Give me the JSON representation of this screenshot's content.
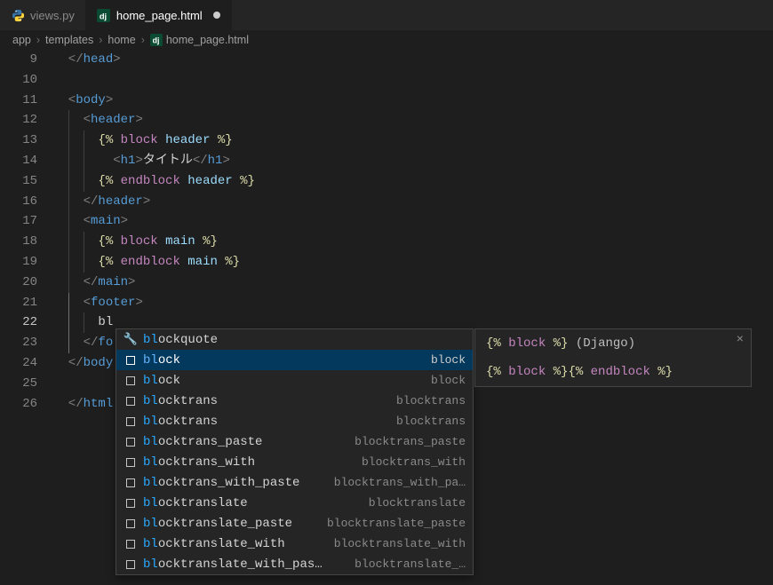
{
  "tabs": [
    {
      "label": "views.py",
      "active": false,
      "icon": "python"
    },
    {
      "label": "home_page.html",
      "active": true,
      "icon": "django",
      "dirty": true
    }
  ],
  "breadcrumbs": {
    "parts": [
      "app",
      "templates",
      "home",
      "home_page.html"
    ],
    "fileIcon": "django"
  },
  "lineNumbers": {
    "start": 9,
    "end": 26,
    "current": 22
  },
  "code": {
    "l9": "</head>",
    "l11_tag": "body",
    "l12_tag": "header",
    "l13_kw": "block",
    "l13_id": "header",
    "l14_tag": "h1",
    "l14_text": "タイトル",
    "l15_kw": "endblock",
    "l15_id": "header",
    "l16_tag": "header",
    "l17_tag": "main",
    "l18_kw": "block",
    "l18_id": "main",
    "l19_kw": "endblock",
    "l19_id": "main",
    "l20_tag": "main",
    "l21_tag": "footer",
    "l22_text": "bl",
    "l23_tag_partial": "fo",
    "l24_tag": "body",
    "l26_tag": "html"
  },
  "autocomplete": {
    "items": [
      {
        "prefix": "bl",
        "rest": "ockquote",
        "right": "",
        "kind": "property",
        "selected": false
      },
      {
        "prefix": "bl",
        "rest": "ock",
        "right": "block",
        "kind": "snippet",
        "selected": true
      },
      {
        "prefix": "bl",
        "rest": "ock",
        "right": "block",
        "kind": "snippet",
        "selected": false
      },
      {
        "prefix": "bl",
        "rest": "ocktrans",
        "right": "blocktrans",
        "kind": "snippet",
        "selected": false
      },
      {
        "prefix": "bl",
        "rest": "ocktrans",
        "right": "blocktrans",
        "kind": "snippet",
        "selected": false
      },
      {
        "prefix": "bl",
        "rest": "ocktrans_paste",
        "right": "blocktrans_paste",
        "kind": "snippet",
        "selected": false
      },
      {
        "prefix": "bl",
        "rest": "ocktrans_with",
        "right": "blocktrans_with",
        "kind": "snippet",
        "selected": false
      },
      {
        "prefix": "bl",
        "rest": "ocktrans_with_paste",
        "right": "blocktrans_with_pa…",
        "kind": "snippet",
        "selected": false
      },
      {
        "prefix": "bl",
        "rest": "ocktranslate",
        "right": "blocktranslate",
        "kind": "snippet",
        "selected": false
      },
      {
        "prefix": "bl",
        "rest": "ocktranslate_paste",
        "right": "blocktranslate_paste",
        "kind": "snippet",
        "selected": false
      },
      {
        "prefix": "bl",
        "rest": "ocktranslate_with",
        "right": "blocktranslate_with",
        "kind": "snippet",
        "selected": false
      },
      {
        "prefix": "bl",
        "rest": "ocktranslate_with_pas…",
        "right": "blocktranslate_…",
        "kind": "snippet",
        "selected": false
      }
    ]
  },
  "doc": {
    "title_open": "{%",
    "title_kw": "block",
    "title_close": "%}",
    "title_tail": " (Django)",
    "body_open1": "{%",
    "body_kw1": "block",
    "body_mid": "  %}{%",
    "body_kw2": "endblock",
    "body_close": "  %}"
  }
}
